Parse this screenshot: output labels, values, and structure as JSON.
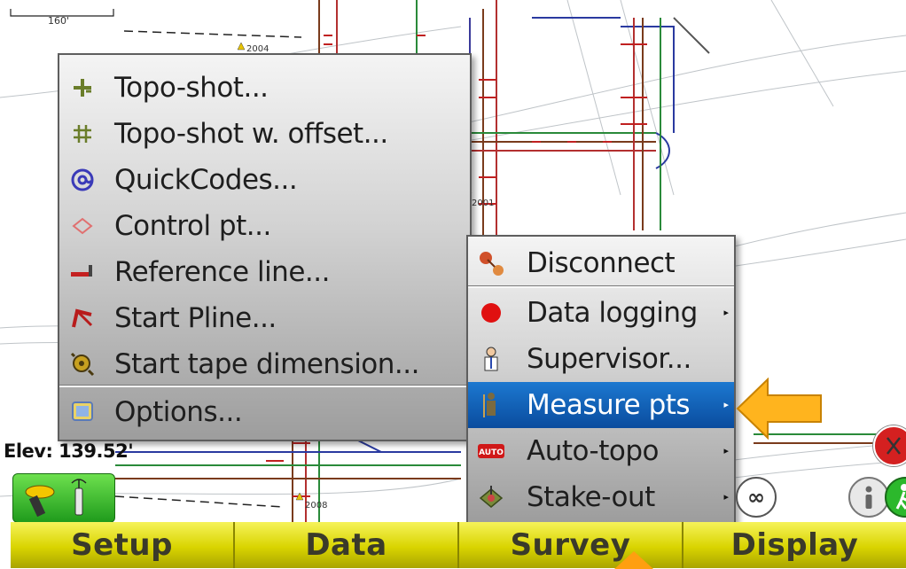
{
  "map": {
    "scale_label": "160'",
    "point_labels": [
      "2004",
      "2001",
      "2008"
    ],
    "elevation": "Elev: 139.52'"
  },
  "survey_menu": {
    "items": [
      {
        "label": "Disconnect",
        "icon": "disconnect-icon"
      },
      {
        "label": "Data logging",
        "icon": "red-dot-icon",
        "has_submenu": true
      },
      {
        "label": "Supervisor...",
        "icon": "supervisor-icon"
      },
      {
        "label": "Measure pts",
        "icon": "measure-pts-icon",
        "has_submenu": true,
        "selected": true
      },
      {
        "label": "Auto-topo",
        "icon": "auto-topo-icon",
        "has_submenu": true
      },
      {
        "label": "Stake-out",
        "icon": "stakeout-icon",
        "has_submenu": true
      }
    ]
  },
  "measure_submenu": {
    "items": [
      {
        "label": "Topo-shot...",
        "icon": "topo-shot-icon"
      },
      {
        "label": "Topo-shot w. offset...",
        "icon": "topo-offset-icon"
      },
      {
        "label": "QuickCodes...",
        "icon": "quickcodes-icon"
      },
      {
        "label": "Control pt...",
        "icon": "control-pt-icon"
      },
      {
        "label": "Reference line...",
        "icon": "reference-line-icon"
      },
      {
        "label": "Start Pline...",
        "icon": "pline-icon"
      },
      {
        "label": "Start tape dimension...",
        "icon": "tape-dimension-icon"
      },
      {
        "label": "Options...",
        "icon": "options-icon"
      }
    ]
  },
  "tabs": [
    "Setup",
    "Data",
    "Survey",
    "Display"
  ],
  "colors": {
    "tab_gradient_top": "#f6f35a",
    "tab_gradient_bottom": "#a9a400",
    "selection": "#0a4c9e",
    "callout": "#ffb41e"
  }
}
